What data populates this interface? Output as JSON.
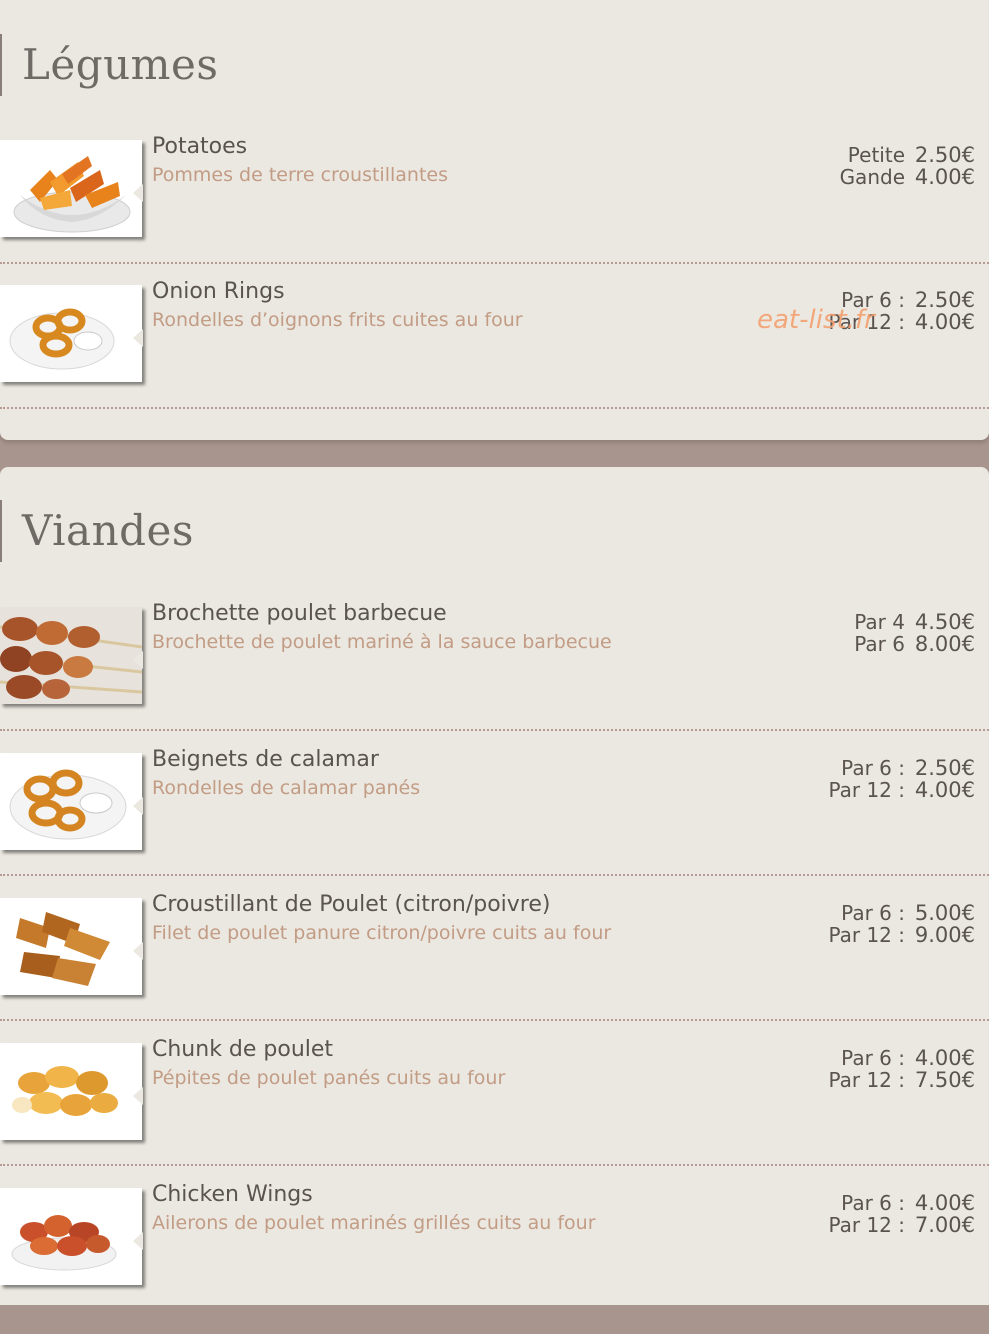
{
  "watermark": "eat-list.fr",
  "sections": [
    {
      "title": "Légumes",
      "items": [
        {
          "name": "Potatoes",
          "desc": "Pommes de terre croustillantes",
          "prices": [
            {
              "label": "Petite",
              "value": "2.50€"
            },
            {
              "label": "Gande",
              "value": "4.00€"
            }
          ]
        },
        {
          "name": "Onion Rings",
          "desc": "Rondelles d’oignons frits cuites au four",
          "prices": [
            {
              "label": "Par 6 :",
              "value": "2.50€"
            },
            {
              "label": "Par 12 :",
              "value": "4.00€"
            }
          ]
        }
      ]
    },
    {
      "title": "Viandes",
      "items": [
        {
          "name": "Brochette poulet barbecue",
          "desc": "Brochette de poulet mariné à la sauce barbecue",
          "prices": [
            {
              "label": "Par 4",
              "value": "4.50€"
            },
            {
              "label": "Par 6",
              "value": "8.00€"
            }
          ]
        },
        {
          "name": "Beignets de calamar",
          "desc": "Rondelles de calamar panés",
          "prices": [
            {
              "label": "Par 6 :",
              "value": "2.50€"
            },
            {
              "label": "Par 12 :",
              "value": "4.00€"
            }
          ]
        },
        {
          "name": "Croustillant de Poulet (citron/poivre)",
          "desc": "Filet de poulet panure citron/poivre cuits au four",
          "prices": [
            {
              "label": "Par 6 :",
              "value": "5.00€"
            },
            {
              "label": "Par 12 :",
              "value": "9.00€"
            }
          ]
        },
        {
          "name": "Chunk de poulet",
          "desc": "Pépites de poulet panés cuits au four",
          "prices": [
            {
              "label": "Par 6 :",
              "value": "4.00€"
            },
            {
              "label": "Par 12 :",
              "value": "7.50€"
            }
          ]
        },
        {
          "name": "Chicken Wings",
          "desc": "Ailerons de poulet marinés grillés cuits au four",
          "prices": [
            {
              "label": "Par 6 :",
              "value": "4.00€"
            },
            {
              "label": "Par 12 :",
              "value": "7.00€"
            }
          ]
        }
      ]
    }
  ]
}
